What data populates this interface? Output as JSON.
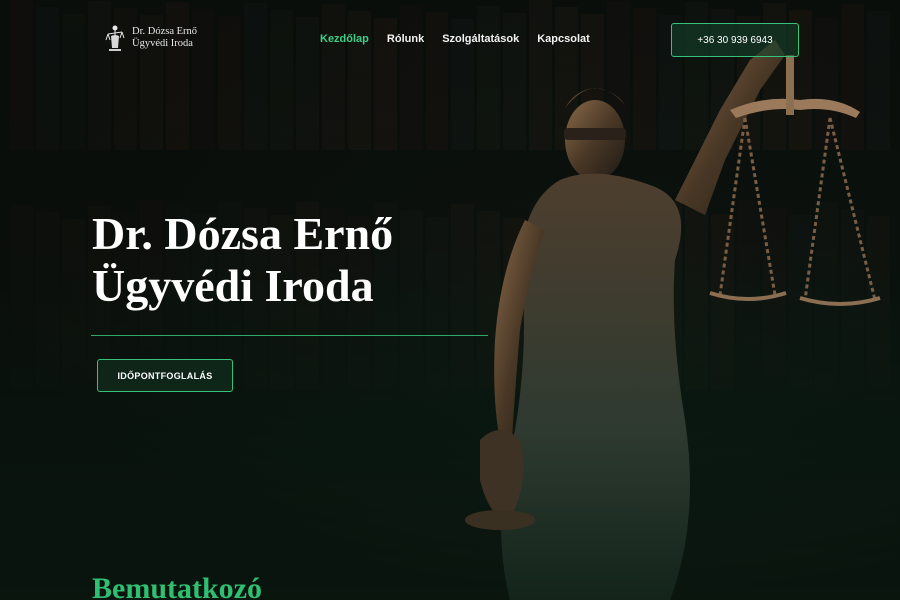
{
  "header": {
    "logo_line1": "Dr. Dózsa Ernő",
    "logo_line2": "Ügyvédi Iroda"
  },
  "nav": {
    "items": [
      {
        "label": "Kezdőlap",
        "active": true
      },
      {
        "label": "Rólunk",
        "active": false
      },
      {
        "label": "Szolgáltatások",
        "active": false
      },
      {
        "label": "Kapcsolat",
        "active": false
      }
    ],
    "phone": "+36 30 939 6943"
  },
  "hero": {
    "title_line1": "Dr. Dózsa Ernő",
    "title_line2": "Ügyvédi Iroda",
    "cta_label": "IDŐPONTFOGLALÁS"
  },
  "intro": {
    "heading": "Bemutatkozó"
  },
  "colors": {
    "accent": "#3ecf86",
    "accent_border": "#36c27a",
    "background_dark": "#0b1610"
  },
  "icons": {
    "logo": "lady-justice-icon"
  }
}
